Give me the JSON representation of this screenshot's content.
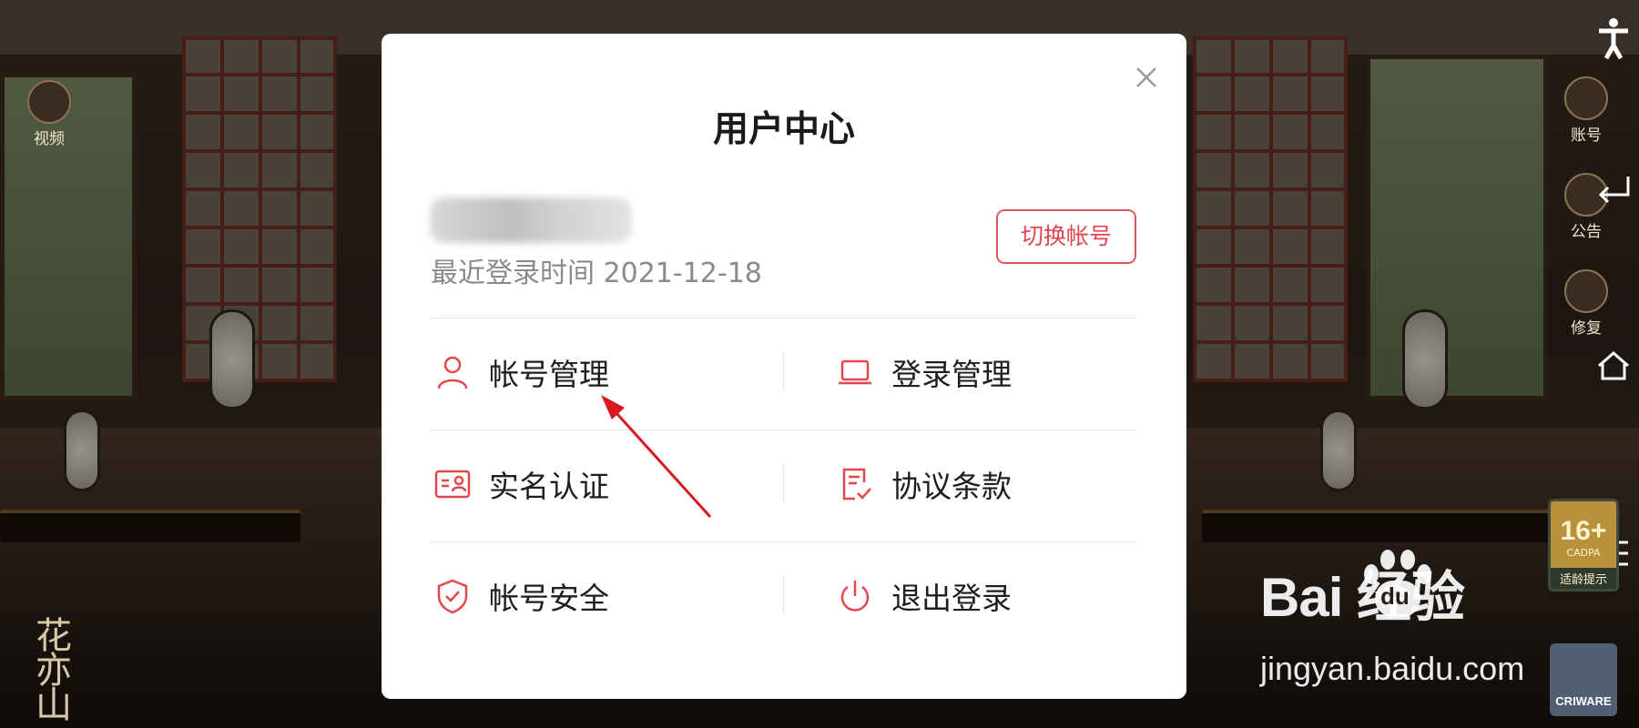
{
  "background": {
    "left_icon_label": "视频",
    "right_icons": [
      {
        "label": "账号",
        "icon": "horse-icon"
      },
      {
        "label": "公告",
        "icon": "notice-icon"
      },
      {
        "label": "修复",
        "icon": "repair-icon"
      }
    ],
    "game_title_mark": "花亦山",
    "age_rating": {
      "number": "16+",
      "org": "CADPA",
      "tip": "适龄提示"
    },
    "criware_label": "CRIWARE",
    "watermark": {
      "logo_text": "Bai  经验",
      "du_text": "du",
      "url": "jingyan.baidu.com"
    }
  },
  "modal": {
    "title": "用户中心",
    "last_login_label": "最近登录时间 2021-12-18",
    "switch_account_label": "切换帐号",
    "menu": [
      {
        "label": "帐号管理",
        "icon": "user-icon"
      },
      {
        "label": "登录管理",
        "icon": "laptop-icon"
      },
      {
        "label": "实名认证",
        "icon": "id-card-icon"
      },
      {
        "label": "协议条款",
        "icon": "document-check-icon"
      },
      {
        "label": "帐号安全",
        "icon": "shield-check-icon"
      },
      {
        "label": "退出登录",
        "icon": "power-icon"
      }
    ]
  },
  "colors": {
    "accent": "#e3464c",
    "annotation_arrow": "#d8191f"
  }
}
